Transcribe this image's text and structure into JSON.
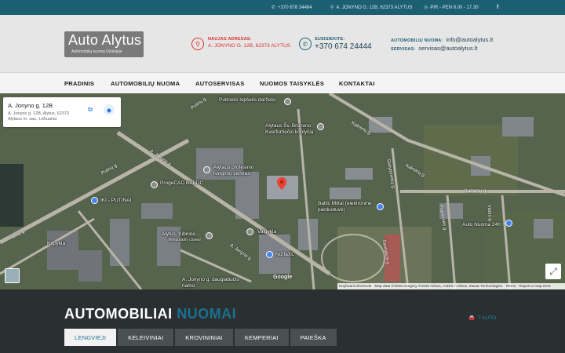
{
  "topbar": {
    "phone": "+370 678 34464",
    "address": "A. JONYNO G. 12B, 62373 ALYTUS",
    "hours": "PIR - PEN 8.00 - 17.30",
    "facebook_icon": "facebook-icon"
  },
  "logo": {
    "name": "Auto Alytus",
    "tagline": "Automobilių nuoma Dzūkijoje"
  },
  "header": {
    "new_address_label": "NAUJAS ADRESAS:",
    "new_address_value": "A. JONYNO G. 12B, 62373 ALYTUS",
    "contact_label": "SUSISIEKITE:",
    "contact_value": "+370 674 24444",
    "rental_label": "AUTOMOBILIŲ NUOMA:",
    "rental_email": "info@autoalytus.lt",
    "service_label": "SERVISAS:",
    "service_email": "servisas@autoalytus.lt"
  },
  "nav": {
    "items": [
      "PRADINIS",
      "AUTOMOBILIŲ NUOMA",
      "AUTOSERVISAS",
      "NUOMOS TAISYKLĖS",
      "KONTAKTAI"
    ]
  },
  "map": {
    "place_title": "A. Jonyno g. 12B",
    "place_address": "A. Jonyno g. 12B, Alytus, 62373 Alytaus m. sav., Lithuania",
    "labels": [
      "Putinėlis lopšelis darželis",
      "Alytaus Šv. Brunono Kverfurtiečio koplyčia",
      "Alytaus profesinio rengimo centras",
      "ProgeCAD BALTIC",
      "IKI - PUTINAI",
      "Alytus, Kibirinė",
      "Temporarily closed",
      "Valgykla",
      "NorfaXL",
      "Baltic Miltai (elektroninė parduotuvė)",
      "Auto Nuoma 24h",
      "Kirpykla",
      "A. Jonyno g. daugiabučio namo"
    ],
    "roads": [
      "Putinų g.",
      "Putinų g.",
      "A. Jonyno g.",
      "A. Jonyno g.",
      "Kalnėnų g.",
      "Kalnėnų g.",
      "Kalnėnų g.",
      "Statybininkų g.",
      "Putinų g.",
      "Pramonės g.",
      "Vilties g.",
      "Santaikos g."
    ],
    "google": "Google",
    "attribution": [
      "Keyboard shortcuts",
      "Map data ©2026 Imagery ©2026 Airbus, CNES / Airbus, Maxar Technologies",
      "Terms",
      "Report a map error"
    ]
  },
  "section": {
    "heading_white": "AUTOMOBILIAI",
    "heading_blue": "NUOMAI",
    "count": "7 AUTO",
    "tabs": [
      "LENGVIEJI",
      "KELEIVINIAI",
      "KROVININIAI",
      "KEMPERIAI",
      "PAIEŠKA"
    ],
    "active_tab": "LENGVIEJI"
  },
  "colors": {
    "topbar": "#1c5f73",
    "accent_red": "#d9322b",
    "accent_blue": "#1c7190",
    "dark_section": "#2a2f31"
  }
}
